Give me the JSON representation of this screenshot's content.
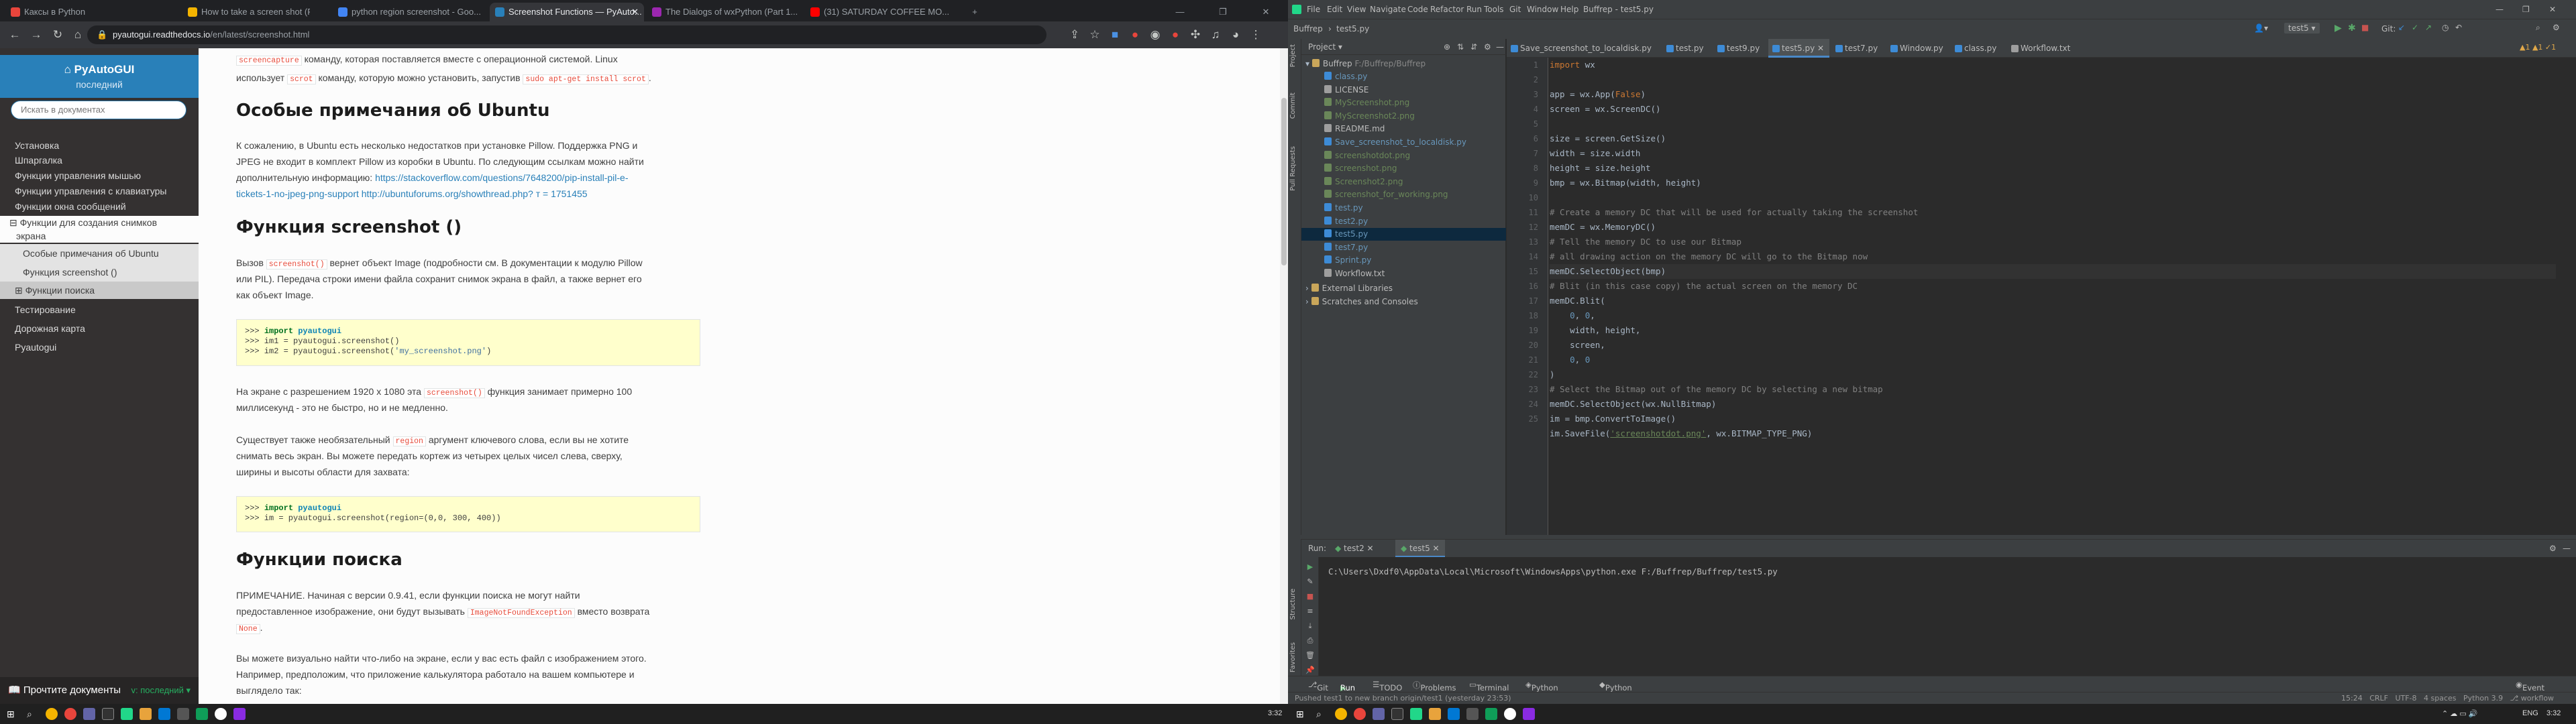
{
  "browser": {
    "tabs": [
      {
        "label": "Каксы в Python",
        "fav": "#e8453c"
      },
      {
        "label": "How to take a screen shot (Pyt...",
        "fav": "#f4b400"
      },
      {
        "label": "python region screenshot - Goo...",
        "fav": "#4285f4"
      },
      {
        "label": "Screenshot Functions — PyAuto...",
        "fav": "#2980b9"
      },
      {
        "label": "The Dialogs of wxPython (Part 1...",
        "fav": "#9c27b0"
      },
      {
        "label": "(31) SATURDAY COFFEE MO...",
        "fav": "#ff0000"
      }
    ],
    "url_host": "pyautogui.readthedocs.io",
    "url_path": "/en/latest/screenshot.html"
  },
  "sidebar": {
    "brand": "PyAutoGUI",
    "version": "последний",
    "search_placeholder": "Искать в документах",
    "items": [
      {
        "label": "Установка",
        "kind": "top"
      },
      {
        "label": "Шпаргалка",
        "kind": "top"
      },
      {
        "label": "Функции управления мышью",
        "kind": "top"
      },
      {
        "label": "Функции управления с клавиатуры",
        "kind": "top"
      },
      {
        "label": "Функции окна сообщений",
        "kind": "top"
      },
      {
        "label": "⊟ Функции для создания снимков",
        "kind": "cur"
      },
      {
        "label": "экрана",
        "kind": "cur"
      },
      {
        "label": "Особые примечания об Ubuntu",
        "kind": "sub"
      },
      {
        "label": "Функция screenshot ()",
        "kind": "sub"
      },
      {
        "label": "⊞ Функции поиска",
        "kind": "sub"
      },
      {
        "label": "Тестирование",
        "kind": "top"
      },
      {
        "label": "Дорожная карта",
        "kind": "top"
      },
      {
        "label": "Pyautogui",
        "kind": "top"
      }
    ],
    "footer_label": "Прочтите документы",
    "footer_version": "v: последний ▾"
  },
  "doc": {
    "line0a": "screencapture",
    "line0b": " команду, которая поставляется вместе с операционной системой. Linux",
    "line1a": "использует ",
    "line1code": "scrot",
    "line1b": " команду, которую можно установить, запустив ",
    "line1code2": "sudo apt-get install scrot",
    "line1c": ".",
    "h_ubuntu": "Особые примечания об Ubuntu",
    "ubuntu_p1": "К сожалению, в Ubuntu есть несколько недостатков при установке Pillow. Поддержка PNG и",
    "ubuntu_p2": "JPEG не входит в комплект Pillow из коробки в Ubuntu. По следующим ссылкам можно найти",
    "ubuntu_p3": "дополнительную информацию: ",
    "ubuntu_link1": "https://stackoverflow.com/questions/7648200/pip-install-pil-e-",
    "ubuntu_link2": "tickets-1-no-jpeg-png-support",
    "ubuntu_link3": " http://ubuntuforums.org/showthread.php? т = 1751455",
    "h_screenshot": "Функция screenshot ()",
    "ss_p1a": "Вызов ",
    "ss_p1code": "screenshot()",
    "ss_p1b": " вернет объект Image (подробности см. В документации к модулю Pillow",
    "ss_p2": "или PIL). Передача строки имени файла сохранит снимок экрана в файл, а также вернет его",
    "ss_p3": "как объект Image.",
    "code1": [
      ">>> ",
      "import",
      " ",
      "pyautogui",
      ">>> im1 = pyautogui.screenshot()",
      ">>> im2 = pyautogui.screenshot(",
      "'my_screenshot.png'",
      ")"
    ],
    "perf_p1a": "На экране с разрешением 1920 x 1080 эта ",
    "perf_p1code": "screenshot()",
    "perf_p1b": " функция занимает примерно 100",
    "perf_p2": "миллисекунд - это не быстро, но и не медленно.",
    "region_p1a": "Существует также необязательный ",
    "region_p1code": "region",
    "region_p1b": " аргумент ключевого слова, если вы не хотите",
    "region_p2": "снимать весь экран. Вы можете передать кортеж из четырех целых чисел слева, сверху,",
    "region_p3": "ширины и высоты области для захвата:",
    "code2": [
      ">>> ",
      "import",
      " ",
      "pyautogui",
      ">>> im = pyautogui.screenshot(region=(0,0, 300, 400))"
    ],
    "h_search": "Функции поиска",
    "search_p1": "ПРИМЕЧАНИЕ. Начиная с версии 0.9.41, если функции поиска не могут найти",
    "search_p2a": "предоставленное изображение, они будут вызывать ",
    "search_p2code": "ImageNotFoundException",
    "search_p2b": " вместо возврата",
    "search_p3code": "None",
    "search_p3b": ".",
    "search_p4": "Вы можете визуально найти что-либо на экране, если у вас есть файл с изображением этого.",
    "search_p5": "Например, предположим, что приложение калькулятора работало на вашем компьютере и",
    "search_p6": "выглядело так:"
  },
  "ide": {
    "title": "Buffrep - test5.py",
    "menu": [
      "File",
      "Edit",
      "View",
      "Navigate",
      "Code",
      "Refactor",
      "Run",
      "Tools",
      "Git",
      "Window",
      "Help"
    ],
    "breadcrumb_project": "Buffrep",
    "breadcrumb_file": "test5.py",
    "run_config": "test5",
    "git_label": "Git:",
    "project_label": "Project ▾",
    "root_label": "Buffrep",
    "root_path": "F:/Buffrep/Buffrep",
    "files": [
      {
        "name": "class.py",
        "color": "#3d8bd6"
      },
      {
        "name": "LICENSE",
        "color": "#9e9e9e"
      },
      {
        "name": "MyScreenshot.png",
        "color": "#6a8759"
      },
      {
        "name": "MyScreenshot2.png",
        "color": "#6a8759"
      },
      {
        "name": "README.md",
        "color": "#9e9e9e"
      },
      {
        "name": "Save_screenshot_to_localdisk.py",
        "color": "#3d8bd6"
      },
      {
        "name": "screenshotdot.png",
        "color": "#6a8759"
      },
      {
        "name": "screenshot.png",
        "color": "#6a8759"
      },
      {
        "name": "Screenshot2.png",
        "color": "#6a8759"
      },
      {
        "name": "screenshot_for_working.png",
        "color": "#6a8759"
      },
      {
        "name": "test.py",
        "color": "#3d8bd6"
      },
      {
        "name": "test2.py",
        "color": "#3d8bd6"
      },
      {
        "name": "test5.py",
        "color": "#3d8bd6"
      },
      {
        "name": "test7.py",
        "color": "#3d8bd6"
      },
      {
        "name": "Sprint.py",
        "color": "#3d8bd6"
      },
      {
        "name": "Workflow.txt",
        "color": "#9e9e9e"
      }
    ],
    "ext_libs": "External Libraries",
    "scratches": "Scratches and Consoles",
    "editor_tabs": [
      "Save_screenshot_to_localdisk.py",
      "test.py",
      "test9.py",
      "test5.py",
      "test7.py",
      "Window.py",
      "class.py",
      "Workflow.txt"
    ],
    "active_tab": "test5.py",
    "warnings": "▲1 ▲1 ✓1",
    "line_numbers": [
      "1",
      "2",
      "3",
      "4",
      "5",
      "6",
      "7",
      "8",
      "9",
      "10",
      "11",
      "12",
      "13",
      "14",
      "15",
      "16",
      "17",
      "18",
      "19",
      "20",
      "21",
      "22",
      "23",
      "24",
      "25"
    ],
    "code": {
      "l1a": "import",
      "l1b": " wx",
      "l3a": "app = wx.App(",
      "l3b": "False",
      "l3c": ")",
      "l4": "screen = wx.ScreenDC()",
      "l6": "size = screen.GetSize()",
      "l7": "width = size.width",
      "l8": "height = size.height",
      "l9": "bmp = wx.Bitmap(width, height)",
      "l11": "# Create a memory DC that will be used for actually taking the screenshot",
      "l12": "memDC = wx.MemoryDC()",
      "l13": "# Tell the memory DC to use our Bitmap",
      "l14": "# all drawing action on the memory DC will go to the Bitmap now",
      "l15": "memDC.SelectObject(bmp)",
      "l16": "# Blit (in this case copy) the actual screen on the memory DC",
      "l17": "memDC.Blit(",
      "l18a": "    ",
      "l18b": "0",
      "l18c": ", ",
      "l18d": "0",
      "l18e": ",",
      "l19": "    width, height,",
      "l20": "    screen,",
      "l21a": "    ",
      "l21b": "0",
      "l21c": ", ",
      "l21d": "0",
      "l22": ")",
      "l23": "# Select the Bitmap out of the memory DC by selecting a new bitmap",
      "l24": "memDC.SelectObject(wx.NullBitmap)",
      "l25": "im = bmp.ConvertToImage()",
      "l26a": "im.SaveFile(",
      "l26b": "'screenshotdot.png'",
      "l26c": ", wx.BITMAP_TYPE_PNG)"
    },
    "run": {
      "label": "Run:",
      "tabs": [
        "test2",
        "test5"
      ],
      "output": "C:\\Users\\Dxdf0\\AppData\\Local\\Microsoft\\WindowsApps\\python.exe F:/Buffrep/Buffrep/test5.py"
    },
    "toolwindows": [
      "Git",
      "Run",
      "TODO",
      "Problems",
      "Terminal",
      "Python Packages",
      "Python Console"
    ],
    "event_log": "Event Log",
    "status_msg": "Pushed test1 to new branch origin/test1 (yesterday 23:53)",
    "status_right": "15:24   CRLF   UTF-8   4 spaces   Python 3.9   ⎇ workflow"
  },
  "taskbar": {
    "time": "3:32",
    "lang": "ENG"
  }
}
